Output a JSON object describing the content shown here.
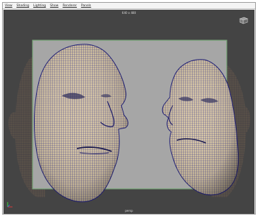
{
  "menu": {
    "items": [
      {
        "label": "View"
      },
      {
        "label": "Shading"
      },
      {
        "label": "Lighting"
      },
      {
        "label": "Show"
      },
      {
        "label": "Renderer"
      },
      {
        "label": "Panels"
      }
    ]
  },
  "viewport": {
    "top_label": "640 x 480",
    "bottom_label": "persp"
  },
  "colors": {
    "viewport_bg": "#444444",
    "image_plane": "#a6a6a6",
    "image_plane_border": "#7aa87a",
    "wireframe": "#1f1f8a",
    "skin": "#d8c7a6"
  },
  "icons": {
    "view_cube": "view-cube-icon",
    "axis": "axis-gizmo-icon"
  }
}
